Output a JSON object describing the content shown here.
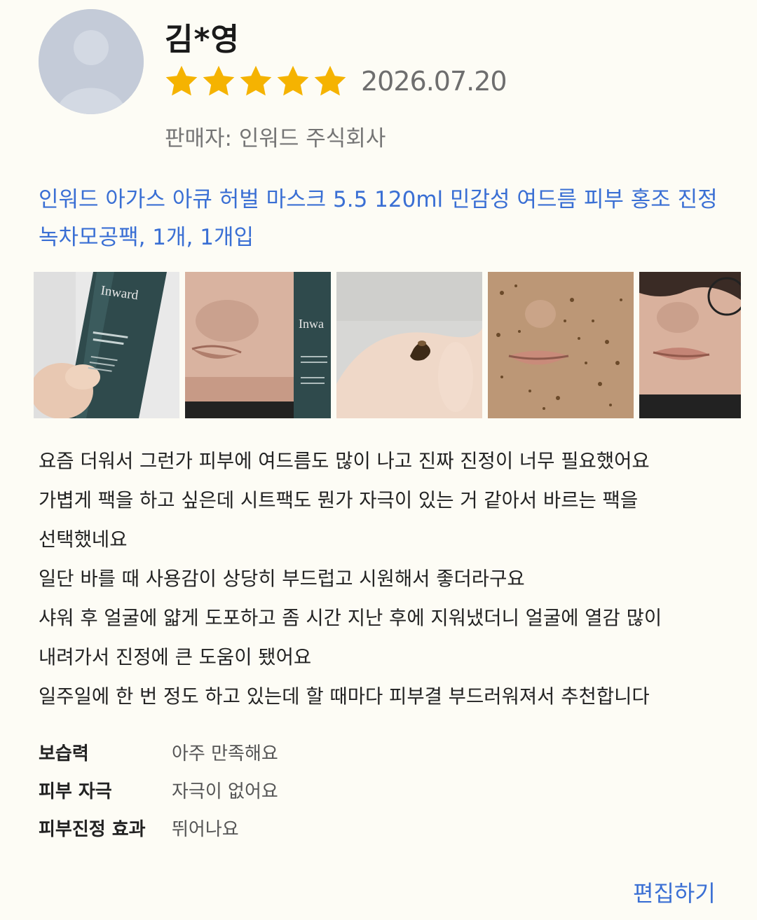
{
  "reviewer": {
    "name": "김*영",
    "rating": 5,
    "rating_max": 5,
    "date": "2026.07.20"
  },
  "seller": {
    "label": "판매자: 인워드 주식회사"
  },
  "product": {
    "name": "인워드 아가스 아큐 허벌 마스크 5.5 120ml 민감성 여드름 피부 홍조 진정 녹차모공팩, 1개, 1개입"
  },
  "photos": [
    {
      "subject": "tube-in-hand",
      "text": "Inward"
    },
    {
      "subject": "face-with-tube",
      "text": "Inwa"
    },
    {
      "subject": "product-on-palm"
    },
    {
      "subject": "face-with-mask"
    },
    {
      "subject": "face-after"
    }
  ],
  "review": {
    "lines": [
      "요즘 더워서 그런가 피부에 여드름도 많이 나고 진짜 진정이 너무 필요했어요",
      "가볍게 팩을 하고 싶은데 시트팩도 뭔가 자극이 있는 거 같아서 바르는 팩을",
      "선택했네요",
      "일단 바를 때 사용감이 상당히 부드럽고 시원해서 좋더라구요",
      "샤워 후 얼굴에 얇게 도포하고 좀 시간 지난 후에 지워냈더니 얼굴에 열감 많이",
      "내려가서 진정에 큰 도움이 됐어요",
      "일주일에 한 번 정도 하고 있는데 할 때마다 피부결 부드러워져서 추천합니다"
    ]
  },
  "survey": [
    {
      "label": "보습력",
      "value": "아주 만족해요"
    },
    {
      "label": "피부 자극",
      "value": "자극이 없어요"
    },
    {
      "label": "피부진정 효과",
      "value": "뛰어나요"
    }
  ],
  "actions": {
    "edit_label": "편집하기"
  },
  "colors": {
    "background": "#fdfcf5",
    "accent": "#3a6fd4",
    "star": "#f5b301",
    "avatar": "#c4cbd8"
  },
  "icons": {
    "avatar": "person-silhouette-icon",
    "star": "star-icon"
  }
}
